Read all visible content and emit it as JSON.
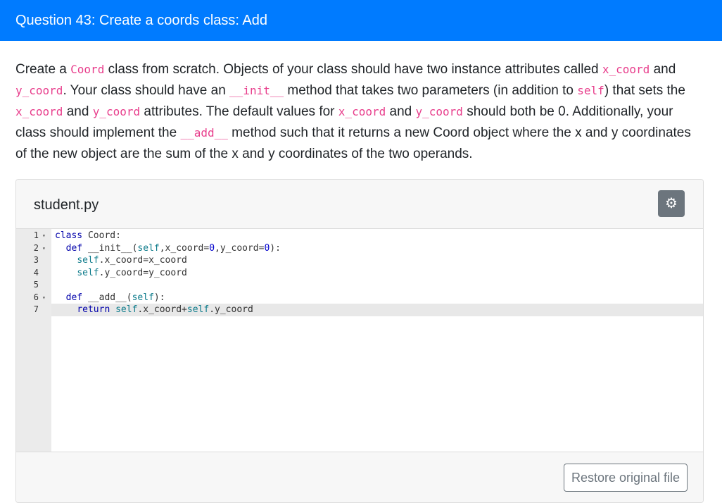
{
  "header": {
    "title": "Question 43: Create a coords class: Add"
  },
  "prompt": {
    "t1": "Create a ",
    "c1": "Coord",
    "t2": " class from scratch. Objects of your class should have two instance attributes called ",
    "c2": "x_coord",
    "t3": " and ",
    "c3": "y_coord",
    "t4": ". Your class should have an ",
    "c4": "__init__",
    "t5": " method that takes two parameters (in addition to ",
    "c5": "self",
    "t6": ") that sets the ",
    "c6": "x_coord",
    "t7": " and ",
    "c7": "y_coord",
    "t8": " attributes. The default values for ",
    "c8": "x_coord",
    "t9": " and ",
    "c9": "y_coord",
    "t10": " should both be 0. Additionally, your class should implement the ",
    "c10": "__add__",
    "t11": " method such that it returns a new Coord object where the x and y coordinates of the new object are the sum of the x and y coordinates of the two operands."
  },
  "file": {
    "name": "student.py",
    "settings_icon": "gear-icon",
    "restore_label": "Restore original file"
  },
  "editor": {
    "line_numbers": [
      "1",
      "2",
      "3",
      "4",
      "5",
      "6",
      "7"
    ],
    "fold_marker": "▾",
    "lines": {
      "l1": {
        "kw": "class",
        "rest": " Coord:"
      },
      "l2": {
        "indent": "  ",
        "kw": "def",
        "name": " __init__",
        "open": "(",
        "self": "self",
        "args": ",x_coord=",
        "n1": "0",
        "mid": ",y_coord=",
        "n2": "0",
        "close": "):"
      },
      "l3": {
        "indent": "    ",
        "self": "self",
        "rest": ".x_coord=x_coord"
      },
      "l4": {
        "indent": "    ",
        "self": "self",
        "rest": ".y_coord=y_coord"
      },
      "l5": {
        "text": ""
      },
      "l6": {
        "indent": "  ",
        "kw": "def",
        "name": " __add__",
        "open": "(",
        "self": "self",
        "close": "):"
      },
      "l7": {
        "indent": "    ",
        "kw": "return",
        "sp": " ",
        "self1": "self",
        "mid": ".x_coord+",
        "self2": "self",
        "rest": ".y_coord"
      }
    }
  },
  "colors": {
    "header_bg": "#007bff",
    "inline_code": "#e83e8c",
    "settings_button": "#6c757d"
  }
}
